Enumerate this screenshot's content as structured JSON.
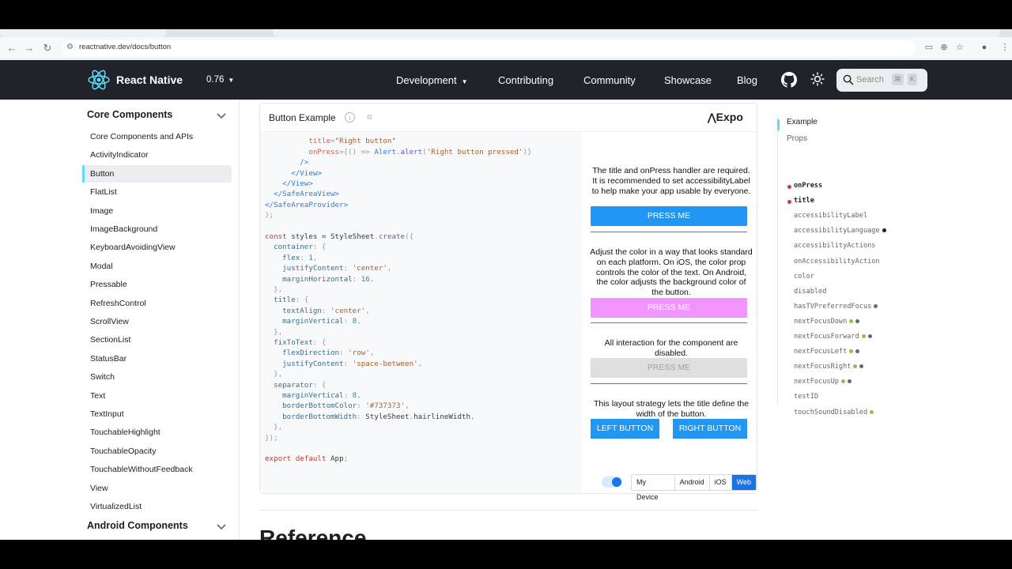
{
  "browser": {
    "url": "reactnative.dev/docs/button"
  },
  "navbar": {
    "brand": "React Native",
    "version": "0.76",
    "links": [
      "Development",
      "Contributing",
      "Community",
      "Showcase",
      "Blog"
    ],
    "search_placeholder": "Search",
    "search_keys": [
      "⌘",
      "K"
    ]
  },
  "sidebar": {
    "section_title": "Core Components",
    "items": [
      "Core Components and APIs",
      "ActivityIndicator",
      "Button",
      "FlatList",
      "Image",
      "ImageBackground",
      "KeyboardAvoidingView",
      "Modal",
      "Pressable",
      "RefreshControl",
      "ScrollView",
      "SectionList",
      "StatusBar",
      "Switch",
      "Text",
      "TextInput",
      "TouchableHighlight",
      "TouchableOpacity",
      "TouchableWithoutFeedback",
      "View",
      "VirtualizedList"
    ],
    "active_item": "Button",
    "next_section_title": "Android Components"
  },
  "example": {
    "title": "Button Example",
    "expo_label": "Expo",
    "preview": {
      "text1": "The title and onPress handler are required. It is recommended to set accessibilityLabel to help make your app usable by everyone.",
      "button1": "PRESS ME",
      "text2": "Adjust the color in a way that looks standard on each platform. On iOS, the color prop controls the color of the text. On Android, the color adjusts the background color of the button.",
      "button2": "PRESS ME",
      "text3": "All interaction for the component are disabled.",
      "button3": "PRESS ME",
      "text4": "This layout strategy lets the title define the width of the button.",
      "left_button": "LEFT BUTTON",
      "right_button": "RIGHT BUTTON"
    },
    "platforms": [
      "My Device",
      "Android",
      "iOS",
      "Web"
    ],
    "selected_platform": "Web",
    "colors": {
      "primary": "#2196f3",
      "pink": "#f194ff",
      "disabled_bg": "#dfdfdf",
      "disabled_text": "#a1a1a1"
    }
  },
  "reference_heading": "Reference",
  "toc": {
    "example": "Example",
    "props": "Props",
    "items": [
      {
        "name": "onPress",
        "required": true,
        "dots": []
      },
      {
        "name": "title",
        "required": true,
        "dots": []
      },
      {
        "name": "accessibilityLabel",
        "dots": []
      },
      {
        "name": "accessibilityLanguage",
        "dots": [
          "#1c1e21"
        ]
      },
      {
        "name": "accessibilityActions",
        "dots": []
      },
      {
        "name": "onAccessibilityAction",
        "dots": []
      },
      {
        "name": "color",
        "dots": []
      },
      {
        "name": "disabled",
        "dots": []
      },
      {
        "name": "hasTVPreferredFocus",
        "dots": [
          "#5f6b7a"
        ]
      },
      {
        "name": "nextFocusDown",
        "dots": [
          "#8bc34a",
          "#5f6b7a"
        ]
      },
      {
        "name": "nextFocusForward",
        "dots": [
          "#8bc34a",
          "#5f6b7a"
        ]
      },
      {
        "name": "nextFocusLeft",
        "dots": [
          "#8bc34a",
          "#5f6b7a"
        ]
      },
      {
        "name": "nextFocusRight",
        "dots": [
          "#8bc34a",
          "#5f6b7a"
        ]
      },
      {
        "name": "nextFocusUp",
        "dots": [
          "#8bc34a",
          "#5f6b7a"
        ]
      },
      {
        "name": "testID",
        "dots": []
      },
      {
        "name": "touchSoundDisabled",
        "dots": [
          "#8bc34a"
        ]
      }
    ]
  },
  "code_lines": [
    [
      [
        "        ",
        "t-plain"
      ],
      [
        "<Button",
        "t-tag"
      ]
    ],
    [
      [
        "          ",
        "t-plain"
      ],
      [
        "title",
        "t-attr"
      ],
      [
        "=",
        "t-pun"
      ],
      [
        "\"Right button\"",
        "t-str"
      ]
    ],
    [
      [
        "          ",
        "t-plain"
      ],
      [
        "onPress",
        "t-attr"
      ],
      [
        "={() => ",
        "t-pun"
      ],
      [
        "Alert",
        "t-tag"
      ],
      [
        ".",
        "t-pun"
      ],
      [
        "alert",
        "t-fn"
      ],
      [
        "(",
        "t-pun"
      ],
      [
        "'Right button pressed'",
        "t-str"
      ],
      [
        ")}",
        "t-pun"
      ]
    ],
    [
      [
        "        ",
        "t-plain"
      ],
      [
        "/>",
        "t-tag"
      ]
    ],
    [
      [
        "      ",
        "t-plain"
      ],
      [
        "</View>",
        "t-tag"
      ]
    ],
    [
      [
        "    ",
        "t-plain"
      ],
      [
        "</View>",
        "t-tag"
      ]
    ],
    [
      [
        "  ",
        "t-plain"
      ],
      [
        "</SafeAreaView>",
        "t-tag"
      ]
    ],
    [
      [
        "",
        "t-plain"
      ],
      [
        "</SafeAreaProvider>",
        "t-tag"
      ]
    ],
    [
      [
        ");",
        "t-pun"
      ]
    ],
    [
      [
        "",
        "t-plain"
      ]
    ],
    [
      [
        "const",
        "t-kw"
      ],
      [
        " styles = ",
        "t-plain"
      ],
      [
        "StyleSheet",
        "t-plain"
      ],
      [
        ".",
        "t-pun"
      ],
      [
        "create",
        "t-fn"
      ],
      [
        "({",
        "t-pun"
      ]
    ],
    [
      [
        "  container",
        "t-prop"
      ],
      [
        ": {",
        "t-pun"
      ]
    ],
    [
      [
        "    flex",
        "t-prop"
      ],
      [
        ": ",
        "t-pun"
      ],
      [
        "1",
        "t-num"
      ],
      [
        ",",
        "t-pun"
      ]
    ],
    [
      [
        "    justifyContent",
        "t-prop"
      ],
      [
        ": ",
        "t-pun"
      ],
      [
        "'center'",
        "t-str"
      ],
      [
        ",",
        "t-pun"
      ]
    ],
    [
      [
        "    marginHorizontal",
        "t-prop"
      ],
      [
        ": ",
        "t-pun"
      ],
      [
        "16",
        "t-num"
      ],
      [
        ",",
        "t-pun"
      ]
    ],
    [
      [
        "  },",
        "t-pun"
      ]
    ],
    [
      [
        "  title",
        "t-prop"
      ],
      [
        ": {",
        "t-pun"
      ]
    ],
    [
      [
        "    textAlign",
        "t-prop"
      ],
      [
        ": ",
        "t-pun"
      ],
      [
        "'center'",
        "t-str"
      ],
      [
        ",",
        "t-pun"
      ]
    ],
    [
      [
        "    marginVertical",
        "t-prop"
      ],
      [
        ": ",
        "t-pun"
      ],
      [
        "8",
        "t-num"
      ],
      [
        ",",
        "t-pun"
      ]
    ],
    [
      [
        "  },",
        "t-pun"
      ]
    ],
    [
      [
        "  fixToText",
        "t-prop"
      ],
      [
        ": {",
        "t-pun"
      ]
    ],
    [
      [
        "    flexDirection",
        "t-prop"
      ],
      [
        ": ",
        "t-pun"
      ],
      [
        "'row'",
        "t-str"
      ],
      [
        ",",
        "t-pun"
      ]
    ],
    [
      [
        "    justifyContent",
        "t-prop"
      ],
      [
        ": ",
        "t-pun"
      ],
      [
        "'space-between'",
        "t-str"
      ],
      [
        ",",
        "t-pun"
      ]
    ],
    [
      [
        "  },",
        "t-pun"
      ]
    ],
    [
      [
        "  separator",
        "t-prop"
      ],
      [
        ": {",
        "t-pun"
      ]
    ],
    [
      [
        "    marginVertical",
        "t-prop"
      ],
      [
        ": ",
        "t-pun"
      ],
      [
        "8",
        "t-num"
      ],
      [
        ",",
        "t-pun"
      ]
    ],
    [
      [
        "    borderBottomColor",
        "t-prop"
      ],
      [
        ": ",
        "t-pun"
      ],
      [
        "'#737373'",
        "t-str"
      ],
      [
        ",",
        "t-pun"
      ]
    ],
    [
      [
        "    borderBottomWidth",
        "t-prop"
      ],
      [
        ": ",
        "t-pun"
      ],
      [
        "StyleSheet",
        "t-plain"
      ],
      [
        ".",
        "t-pun"
      ],
      [
        "hairlineWidth",
        "t-plain"
      ],
      [
        ",",
        "t-pun"
      ]
    ],
    [
      [
        "  },",
        "t-pun"
      ]
    ],
    [
      [
        "});",
        "t-pun"
      ]
    ],
    [
      [
        "",
        "t-plain"
      ]
    ],
    [
      [
        "export",
        "t-kw"
      ],
      [
        " ",
        "t-plain"
      ],
      [
        "default",
        "t-kw"
      ],
      [
        " App",
        "t-plain"
      ],
      [
        ";",
        "t-pun"
      ]
    ]
  ]
}
